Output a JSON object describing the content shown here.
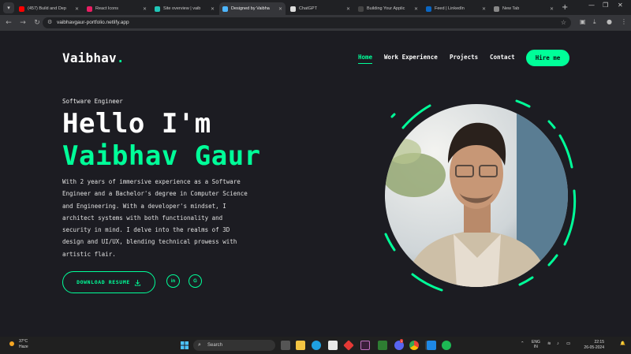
{
  "browser": {
    "tabs": [
      {
        "label": "(457) Build and Dep",
        "fav_color": "#ff0000",
        "active": false
      },
      {
        "label": "React Icons",
        "fav_color": "#e91e63",
        "active": false
      },
      {
        "label": "Site overview | vaib",
        "fav_color": "#20c6b7",
        "active": false
      },
      {
        "label": "Designed by Vaibha",
        "fav_color": "#4db6ff",
        "active": true
      },
      {
        "label": "ChatGPT",
        "fav_color": "#dddddd",
        "active": false
      },
      {
        "label": "Building Your Applic",
        "fav_color": "#444444",
        "active": false
      },
      {
        "label": "Feed | LinkedIn",
        "fav_color": "#0a66c2",
        "active": false
      },
      {
        "label": "New Tab",
        "fav_color": "#888888",
        "active": false
      }
    ],
    "new_tab_symbol": "+",
    "url": "vaibhavgaur-portfolio.netlify.app"
  },
  "site": {
    "logo_text": "Vaibhav",
    "logo_dot": ".",
    "nav": {
      "home": "Home",
      "work": "Work Experience",
      "projects": "Projects",
      "contact": "Contact"
    },
    "hire_label": "Hire me",
    "role": "Software Engineer",
    "greeting": "Hello I'm",
    "name": "Vaibhav Gaur",
    "intro_lines": [
      "With 2 years of immersive experience as a Software",
      "Engineer and a Bachelor's degree in Computer Science",
      "and Engineering. With a developer's mindset, I",
      "architect systems with both functionality and",
      "security in mind. I delve into the realms of 3D",
      "design and UI/UX, blending technical prowess with",
      "artistic flair."
    ],
    "download_label": "DOWNLOAD RESUME",
    "social": {
      "linkedin": "in",
      "other": "G"
    },
    "accent": "#00ff99",
    "background": "#1c1c22"
  },
  "taskbar": {
    "weather_temp": "37°C",
    "weather_desc": "Haze",
    "search_placeholder": "Search",
    "lang_top": "ENG",
    "lang_bottom": "IN",
    "time": "22:15",
    "date": "26-05-2024",
    "notif_badge": "1"
  }
}
